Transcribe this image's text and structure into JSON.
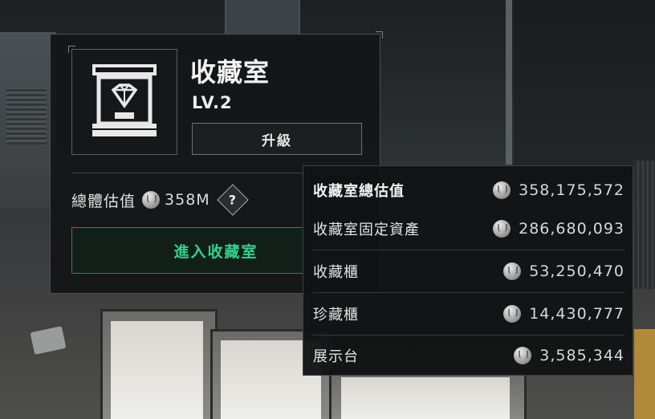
{
  "room": {
    "title": "收藏室",
    "level": "LV.2",
    "upgrade_label": "升級",
    "valuation_label": "總體估值",
    "valuation_value": "358M",
    "help_symbol": "?",
    "enter_label": "進入收藏室"
  },
  "breakdown": {
    "rows": [
      {
        "label": "收藏室總估值",
        "value": "358,175,572"
      },
      {
        "label": "收藏室固定資產",
        "value": "286,680,093"
      },
      {
        "label": "收藏櫃",
        "value": "53,250,470"
      },
      {
        "label": "珍藏櫃",
        "value": "14,430,777"
      },
      {
        "label": "展示台",
        "value": "3,585,344"
      }
    ]
  },
  "icons": {
    "room": "display-case-gem-icon",
    "currency": "silver-coin-icon",
    "help": "question-diamond-icon"
  },
  "colors": {
    "panel_bg": "#141516",
    "accent_green": "#2fd38a",
    "border": "#4b4e50"
  }
}
